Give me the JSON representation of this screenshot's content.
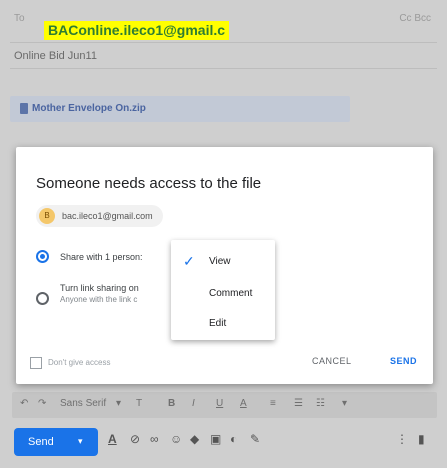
{
  "compose": {
    "to_label": "To",
    "cc_bcc": "Cc Bcc",
    "recipient": "BAConline.ileco1@gmail.c",
    "subject": "Online Bid Jun11",
    "attachment": "Mother Envelope On.zip"
  },
  "dialog": {
    "title": "Someone needs access to the file",
    "chip_avatar": "B",
    "chip_email": "bac.ileco1@gmail.com",
    "option_share": "Share with 1 person:",
    "option_link": "Turn link sharing on",
    "option_link_sub": "Anyone with the link c",
    "dont_give_access": "Don't give access",
    "cancel": "CANCEL",
    "send": "SEND"
  },
  "menu": {
    "check": "✓",
    "items": [
      "View",
      "Comment",
      "Edit"
    ],
    "selected": "View"
  },
  "format_toolbar": {
    "undo": "↶",
    "redo": "↷",
    "font": "Sans Serif",
    "font_caret": "▾",
    "size": "T",
    "bold": "B",
    "italic": "I",
    "underline": "U",
    "color": "A",
    "align": "≡",
    "numbered": "☰",
    "bulleted": "☷",
    "more": "▾"
  },
  "bottom_toolbar": {
    "send": "Send",
    "send_caret": "▾",
    "format": "A",
    "attach": "⊘",
    "link": "∞",
    "emoji": "☺",
    "drive": "◆",
    "photo": "▣",
    "lock": "◐",
    "signature": "✎",
    "more": "⋮",
    "trash": "▮"
  }
}
